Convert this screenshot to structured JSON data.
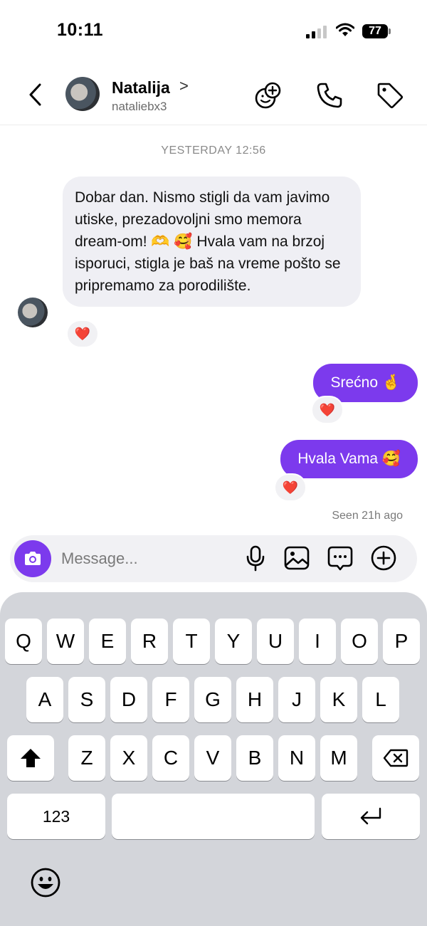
{
  "status_bar": {
    "time": "10:11",
    "battery": "77"
  },
  "header": {
    "name": "Natalija",
    "name_chevron": ">",
    "handle": "nataliebx3",
    "icons": [
      "back-arrow-icon",
      "group-add-icon",
      "phone-icon",
      "tag-icon"
    ]
  },
  "thread": {
    "date_separator": "YESTERDAY 12:56",
    "messages": [
      {
        "direction": "incoming",
        "text": "Dobar dan. Nismo stigli da vam javimo utiske, prezadovoljni smo memora dream-om! 🫶 🥰  Hvala vam na brzoj isporuci, stigla je baš na vreme pošto se pripremamo za porodilište.",
        "reaction": "❤️"
      },
      {
        "direction": "outgoing",
        "text": "Srećno 🤞",
        "reaction": "❤️"
      },
      {
        "direction": "outgoing",
        "text": "Hvala Vama 🥰",
        "reaction": "❤️"
      }
    ],
    "seen": "Seen 21h ago"
  },
  "composer": {
    "placeholder": "Message...",
    "value": "",
    "icons": [
      "camera-icon",
      "microphone-icon",
      "image-icon",
      "sticker-chat-icon",
      "plus-circle-icon"
    ]
  },
  "keyboard": {
    "row1": [
      "Q",
      "W",
      "E",
      "R",
      "T",
      "Y",
      "U",
      "I",
      "O",
      "P"
    ],
    "row2": [
      "A",
      "S",
      "D",
      "F",
      "G",
      "H",
      "J",
      "K",
      "L"
    ],
    "row3": [
      "Z",
      "X",
      "C",
      "V",
      "B",
      "N",
      "M"
    ],
    "numbers_key": "123",
    "icons": [
      "shift-icon",
      "delete-icon",
      "return-icon",
      "emoji-icon"
    ]
  },
  "colors": {
    "accent": "#7c3aed",
    "incoming_bubble": "#efeff4",
    "keyboard_bg": "#d3d5da"
  }
}
